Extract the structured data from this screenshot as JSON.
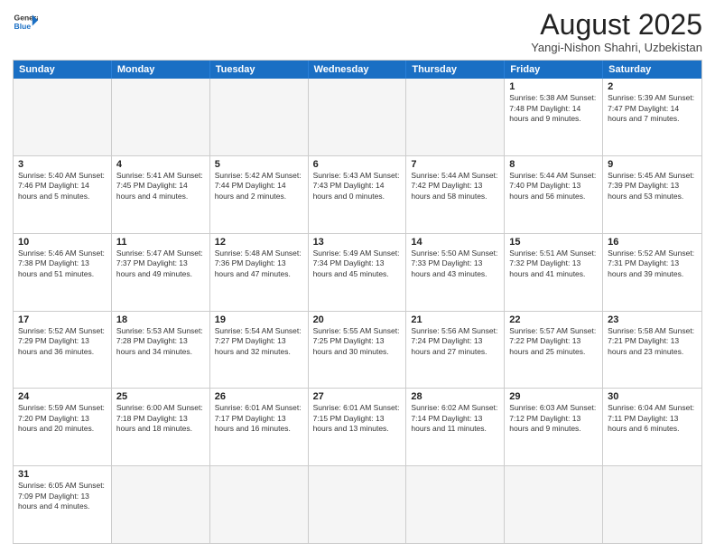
{
  "header": {
    "logo_general": "General",
    "logo_blue": "Blue",
    "month_title": "August 2025",
    "location": "Yangi-Nishon Shahri, Uzbekistan"
  },
  "days_of_week": [
    "Sunday",
    "Monday",
    "Tuesday",
    "Wednesday",
    "Thursday",
    "Friday",
    "Saturday"
  ],
  "rows": [
    [
      {
        "day": "",
        "text": "",
        "empty": true
      },
      {
        "day": "",
        "text": "",
        "empty": true
      },
      {
        "day": "",
        "text": "",
        "empty": true
      },
      {
        "day": "",
        "text": "",
        "empty": true
      },
      {
        "day": "",
        "text": "",
        "empty": true
      },
      {
        "day": "1",
        "text": "Sunrise: 5:38 AM\nSunset: 7:48 PM\nDaylight: 14 hours\nand 9 minutes."
      },
      {
        "day": "2",
        "text": "Sunrise: 5:39 AM\nSunset: 7:47 PM\nDaylight: 14 hours\nand 7 minutes."
      }
    ],
    [
      {
        "day": "3",
        "text": "Sunrise: 5:40 AM\nSunset: 7:46 PM\nDaylight: 14 hours\nand 5 minutes."
      },
      {
        "day": "4",
        "text": "Sunrise: 5:41 AM\nSunset: 7:45 PM\nDaylight: 14 hours\nand 4 minutes."
      },
      {
        "day": "5",
        "text": "Sunrise: 5:42 AM\nSunset: 7:44 PM\nDaylight: 14 hours\nand 2 minutes."
      },
      {
        "day": "6",
        "text": "Sunrise: 5:43 AM\nSunset: 7:43 PM\nDaylight: 14 hours\nand 0 minutes."
      },
      {
        "day": "7",
        "text": "Sunrise: 5:44 AM\nSunset: 7:42 PM\nDaylight: 13 hours\nand 58 minutes."
      },
      {
        "day": "8",
        "text": "Sunrise: 5:44 AM\nSunset: 7:40 PM\nDaylight: 13 hours\nand 56 minutes."
      },
      {
        "day": "9",
        "text": "Sunrise: 5:45 AM\nSunset: 7:39 PM\nDaylight: 13 hours\nand 53 minutes."
      }
    ],
    [
      {
        "day": "10",
        "text": "Sunrise: 5:46 AM\nSunset: 7:38 PM\nDaylight: 13 hours\nand 51 minutes."
      },
      {
        "day": "11",
        "text": "Sunrise: 5:47 AM\nSunset: 7:37 PM\nDaylight: 13 hours\nand 49 minutes."
      },
      {
        "day": "12",
        "text": "Sunrise: 5:48 AM\nSunset: 7:36 PM\nDaylight: 13 hours\nand 47 minutes."
      },
      {
        "day": "13",
        "text": "Sunrise: 5:49 AM\nSunset: 7:34 PM\nDaylight: 13 hours\nand 45 minutes."
      },
      {
        "day": "14",
        "text": "Sunrise: 5:50 AM\nSunset: 7:33 PM\nDaylight: 13 hours\nand 43 minutes."
      },
      {
        "day": "15",
        "text": "Sunrise: 5:51 AM\nSunset: 7:32 PM\nDaylight: 13 hours\nand 41 minutes."
      },
      {
        "day": "16",
        "text": "Sunrise: 5:52 AM\nSunset: 7:31 PM\nDaylight: 13 hours\nand 39 minutes."
      }
    ],
    [
      {
        "day": "17",
        "text": "Sunrise: 5:52 AM\nSunset: 7:29 PM\nDaylight: 13 hours\nand 36 minutes."
      },
      {
        "day": "18",
        "text": "Sunrise: 5:53 AM\nSunset: 7:28 PM\nDaylight: 13 hours\nand 34 minutes."
      },
      {
        "day": "19",
        "text": "Sunrise: 5:54 AM\nSunset: 7:27 PM\nDaylight: 13 hours\nand 32 minutes."
      },
      {
        "day": "20",
        "text": "Sunrise: 5:55 AM\nSunset: 7:25 PM\nDaylight: 13 hours\nand 30 minutes."
      },
      {
        "day": "21",
        "text": "Sunrise: 5:56 AM\nSunset: 7:24 PM\nDaylight: 13 hours\nand 27 minutes."
      },
      {
        "day": "22",
        "text": "Sunrise: 5:57 AM\nSunset: 7:22 PM\nDaylight: 13 hours\nand 25 minutes."
      },
      {
        "day": "23",
        "text": "Sunrise: 5:58 AM\nSunset: 7:21 PM\nDaylight: 13 hours\nand 23 minutes."
      }
    ],
    [
      {
        "day": "24",
        "text": "Sunrise: 5:59 AM\nSunset: 7:20 PM\nDaylight: 13 hours\nand 20 minutes."
      },
      {
        "day": "25",
        "text": "Sunrise: 6:00 AM\nSunset: 7:18 PM\nDaylight: 13 hours\nand 18 minutes."
      },
      {
        "day": "26",
        "text": "Sunrise: 6:01 AM\nSunset: 7:17 PM\nDaylight: 13 hours\nand 16 minutes."
      },
      {
        "day": "27",
        "text": "Sunrise: 6:01 AM\nSunset: 7:15 PM\nDaylight: 13 hours\nand 13 minutes."
      },
      {
        "day": "28",
        "text": "Sunrise: 6:02 AM\nSunset: 7:14 PM\nDaylight: 13 hours\nand 11 minutes."
      },
      {
        "day": "29",
        "text": "Sunrise: 6:03 AM\nSunset: 7:12 PM\nDaylight: 13 hours\nand 9 minutes."
      },
      {
        "day": "30",
        "text": "Sunrise: 6:04 AM\nSunset: 7:11 PM\nDaylight: 13 hours\nand 6 minutes."
      }
    ],
    [
      {
        "day": "31",
        "text": "Sunrise: 6:05 AM\nSunset: 7:09 PM\nDaylight: 13 hours\nand 4 minutes."
      },
      {
        "day": "",
        "text": "",
        "empty": true
      },
      {
        "day": "",
        "text": "",
        "empty": true
      },
      {
        "day": "",
        "text": "",
        "empty": true
      },
      {
        "day": "",
        "text": "",
        "empty": true
      },
      {
        "day": "",
        "text": "",
        "empty": true
      },
      {
        "day": "",
        "text": "",
        "empty": true
      }
    ]
  ]
}
